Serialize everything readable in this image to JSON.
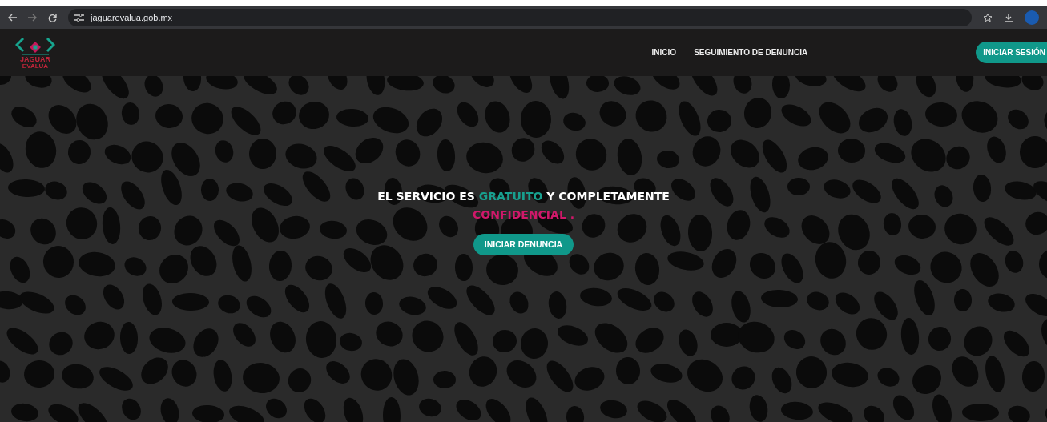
{
  "browser": {
    "url": "jaguarevalua.gob.mx"
  },
  "logo": {
    "line_1": "JAGUAR",
    "line_2": "EVALUA"
  },
  "nav": {
    "links": [
      {
        "label": "INICIO"
      },
      {
        "label": "SEGUIMIENTO DE DENUNCIA"
      }
    ],
    "login_button": "INICIAR SESIÓN"
  },
  "hero": {
    "headline": [
      {
        "kind": "plain",
        "text": "EL SERVICIO ES "
      },
      {
        "kind": "accent",
        "text": "GRATUITO"
      },
      {
        "kind": "plain",
        "text": " Y COMPLETAMENTE "
      },
      {
        "kind": "highlight",
        "text": "CONFIDENCIAL ."
      }
    ],
    "button": "INICIAR DENUNCIA"
  }
}
